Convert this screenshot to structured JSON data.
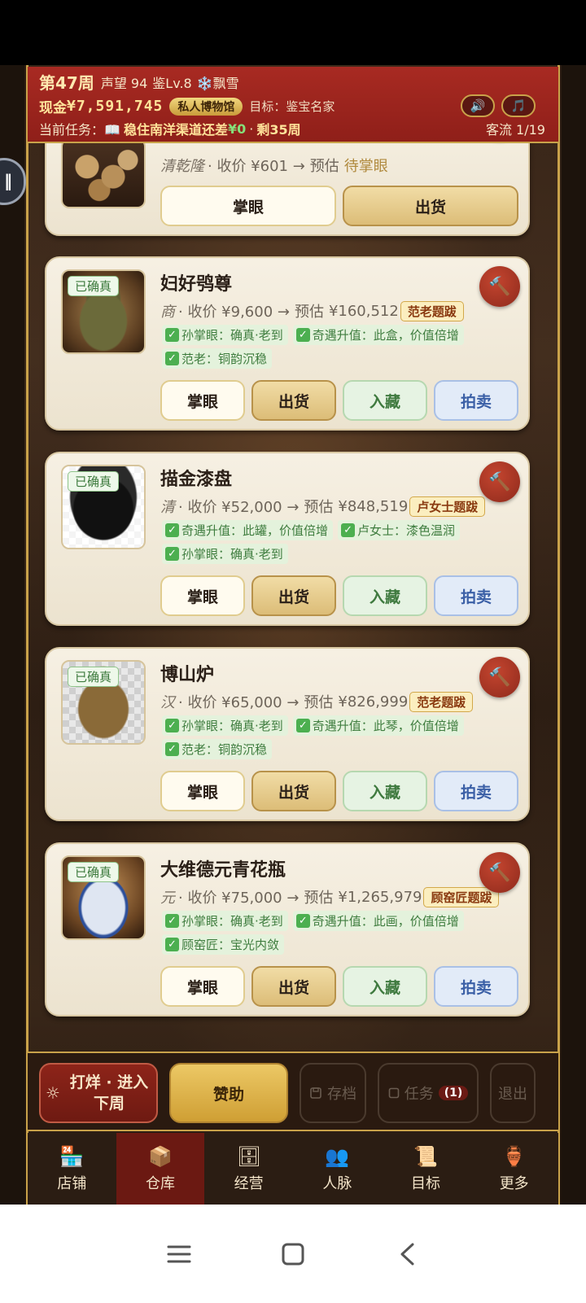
{
  "header": {
    "week": "第47周",
    "reputation": "声望 94",
    "level": "鉴Lv.8",
    "weather": "❄️飘雪",
    "cash_label": "现金",
    "cash": "¥7,591,745",
    "museum_badge": "私人博物馆",
    "goal": "目标：鉴宝名家",
    "task_prefix": "当前任务：📖",
    "task_body": "稳住南洋渠道还差",
    "task_amount": "¥0",
    "task_sep": "·",
    "task_remaining": "剩35周",
    "guests": "客流 1/19",
    "sound_icon": "🔊",
    "music_icon": "🎵"
  },
  "items": [
    {
      "name": "",
      "era": "清乾隆",
      "buy": "· 收价 ¥601 →",
      "est_label": "预估",
      "est": "待掌眼",
      "buttons": [
        "掌眼",
        "出货"
      ]
    },
    {
      "name": "妇好鸮尊",
      "confirmed": "已确真",
      "era": "商",
      "buy": "· 收价 ¥9,600 →",
      "est_label": "预估",
      "est": "¥160,512",
      "tag": "范老题跋",
      "chips": [
        "孙掌眼：确真·老到",
        "奇遇升值：此盒，价值倍增",
        "范老：铜韵沉稳"
      ],
      "buttons": [
        "掌眼",
        "出货",
        "入藏",
        "拍卖"
      ]
    },
    {
      "name": "描金漆盘",
      "confirmed": "已确真",
      "era": "清",
      "buy": "· 收价 ¥52,000 →",
      "est_label": "预估",
      "est": "¥848,519",
      "tag": "卢女士题跋",
      "chips": [
        "奇遇升值：此罐，价值倍增",
        "卢女士：漆色温润",
        "孙掌眼：确真·老到"
      ],
      "buttons": [
        "掌眼",
        "出货",
        "入藏",
        "拍卖"
      ]
    },
    {
      "name": "博山炉",
      "confirmed": "已确真",
      "era": "汉",
      "buy": "· 收价 ¥65,000 →",
      "est_label": "预估",
      "est": "¥826,999",
      "tag": "范老题跋",
      "chips": [
        "孙掌眼：确真·老到",
        "奇遇升值：此琴，价值倍增",
        "范老：铜韵沉稳"
      ],
      "buttons": [
        "掌眼",
        "出货",
        "入藏",
        "拍卖"
      ]
    },
    {
      "name": "大维德元青花瓶",
      "confirmed": "已确真",
      "era": "元",
      "buy": "· 收价 ¥75,000 →",
      "est_label": "预估",
      "est": "¥1,265,979",
      "tag": "顾窑匠题跋",
      "chips": [
        "孙掌眼：确真·老到",
        "奇遇升值：此画，价值倍增",
        "顾窑匠：宝光内敛"
      ],
      "buttons": [
        "掌眼",
        "出货",
        "入藏",
        "拍卖"
      ]
    }
  ],
  "check_mark": "✓",
  "hammer_icon": "🔨",
  "actions": {
    "next_icon": "☼",
    "next_line1": "打烊 · 进入",
    "next_line2": "下周",
    "sponsor": "赞助",
    "save": "存档",
    "task": "任务",
    "task_count": "(1)",
    "exit": "退出"
  },
  "tabs": [
    {
      "icon": "🏪",
      "label": "店铺"
    },
    {
      "icon": "📦",
      "label": "仓库"
    },
    {
      "icon": "🗄",
      "label": "经营"
    },
    {
      "icon": "👥",
      "label": "人脉"
    },
    {
      "icon": "📜",
      "label": "目标"
    },
    {
      "icon": "🏺",
      "label": "更多"
    }
  ],
  "active_tab": "仓库",
  "colors": {
    "header_red": "#a82a22",
    "gold_border": "#c9a24a",
    "card_bg": "#f6f0e3",
    "confirm_green": "#3d7a3d",
    "auction_blue": "#3a5fa6"
  }
}
